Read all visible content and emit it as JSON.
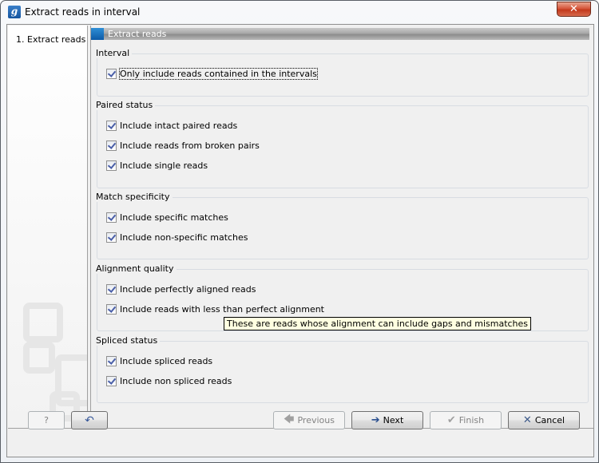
{
  "window": {
    "title": "Extract reads in interval",
    "app_icon": "g-logo-icon",
    "close_label": "✕"
  },
  "steps": [
    {
      "label": "1.  Extract reads"
    }
  ],
  "panel": {
    "header": "Extract reads",
    "groups": [
      {
        "label": "Interval",
        "options": [
          {
            "label": "Only include reads contained in the intervals",
            "checked": true,
            "focused": true
          }
        ]
      },
      {
        "label": "Paired status",
        "options": [
          {
            "label": "Include intact paired reads",
            "checked": true
          },
          {
            "label": "Include reads from broken pairs",
            "checked": true
          },
          {
            "label": "Include single reads",
            "checked": true
          }
        ]
      },
      {
        "label": "Match specificity",
        "options": [
          {
            "label": "Include specific matches",
            "checked": true
          },
          {
            "label": "Include non-specific matches",
            "checked": true
          }
        ]
      },
      {
        "label": "Alignment quality",
        "options": [
          {
            "label": "Include perfectly aligned reads",
            "checked": true
          },
          {
            "label": "Include reads with less than perfect alignment",
            "checked": true
          }
        ]
      },
      {
        "label": "Spliced status",
        "options": [
          {
            "label": "Include spliced reads",
            "checked": true
          },
          {
            "label": "Include non spliced reads",
            "checked": true
          }
        ]
      }
    ],
    "tooltip": "These are reads whose alignment can include gaps and mismatches"
  },
  "footer": {
    "help_label": "?",
    "reset_icon": "undo-arrow-icon",
    "previous_label": "Previous",
    "next_label": "Next",
    "finish_label": "Finish",
    "cancel_label": "Cancel"
  }
}
